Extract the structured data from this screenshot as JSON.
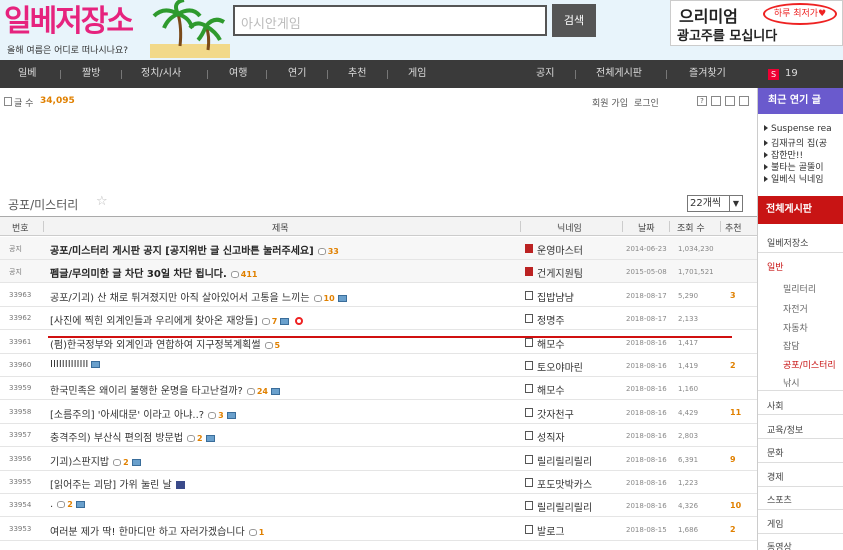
{
  "header": {
    "logo_text": "일베저장소",
    "logo_small": "간",
    "logo_tagline": "올해 여름은 어디로 떠나시나요?",
    "search_placeholder": "아시안게임",
    "search_button": "검색",
    "ad_line1": "으리미엄",
    "ad_line2": "광고주를 모십니다",
    "ad_bubble": "하루 최저가♥"
  },
  "nav": {
    "items": [
      "일베",
      "짤방",
      "정치/시사",
      "여행",
      "연기",
      "추천",
      "게임",
      "공지",
      "전체게시판",
      "즐겨찾기"
    ],
    "badge": "S",
    "count": "19"
  },
  "info": {
    "post_count_label": "글 수",
    "post_count": "34,095",
    "signup": "회원 가입",
    "login": "로그인",
    "btn_help": "?"
  },
  "board": {
    "title": "공포/미스터리",
    "per_page": "22개씩",
    "columns": {
      "num": "번호",
      "title": "제목",
      "nick": "닉네임",
      "date": "날짜",
      "views": "조회 수",
      "rec": "추천"
    }
  },
  "rows": [
    {
      "num": "공지",
      "title": "공포/미스터리 게시판 공지 [공지위반 글 신고바튼 눌러주세요]",
      "comments": "33",
      "img": false,
      "user": "운영마스터",
      "user_red": true,
      "date": "2014-06-23",
      "views": "1,034,230",
      "rec": ""
    },
    {
      "num": "공지",
      "title": "펨글/무의미한 글 차단 30일 차단 됩니다.",
      "comments": "411",
      "img": false,
      "user": "건게지원팀",
      "user_red": true,
      "date": "2015-05-08",
      "views": "1,701,521",
      "rec": ""
    },
    {
      "num": "33963",
      "title": "공포/기괴) 산 채로 튀겨졌지만 아직 살아있어서 고통을 느끼는",
      "comments": "10",
      "img": true,
      "user": "집밥냠냠",
      "user_red": false,
      "date": "2018-08-17",
      "views": "5,290",
      "rec": "3"
    },
    {
      "num": "33962",
      "title": "[사진에 찍힌 외계인들과 우리에게 찾아온 재앙들]",
      "comments": "7",
      "img": true,
      "user": "정명주",
      "user_red": false,
      "date": "2018-08-17",
      "views": "2,133",
      "rec": ""
    },
    {
      "num": "33961",
      "title": "(펌)한국정부와 외계인과 연합하여 지구정복계획썰",
      "comments": "5",
      "img": false,
      "user": "해모수",
      "user_red": false,
      "date": "2018-08-16",
      "views": "1,417",
      "rec": ""
    },
    {
      "num": "33960",
      "title": "IIIIIIIIIIIII",
      "comments": "",
      "img": true,
      "user": "토오야마린",
      "user_red": false,
      "date": "2018-08-16",
      "views": "1,419",
      "rec": "2"
    },
    {
      "num": "33959",
      "title": "한국민족은 왜이리 불행한 운명을 타고난걸까?",
      "comments": "24",
      "img": true,
      "user": "해모수",
      "user_red": false,
      "date": "2018-08-16",
      "views": "1,160",
      "rec": ""
    },
    {
      "num": "33958",
      "title": "[소름주의] '아세대문' 이라고 아냐..?",
      "comments": "3",
      "img": true,
      "user": "갓자천구",
      "user_red": false,
      "date": "2018-08-16",
      "views": "4,429",
      "rec": "11"
    },
    {
      "num": "33957",
      "title": "충격주의) 부산식 편의점 방문법",
      "comments": "2",
      "img": true,
      "user": "성직자",
      "user_red": false,
      "date": "2018-08-16",
      "views": "2,803",
      "rec": ""
    },
    {
      "num": "33956",
      "title": "기괴)스판지밥",
      "comments": "2",
      "img": true,
      "user": "릴리릴리릴리",
      "user_red": false,
      "date": "2018-08-16",
      "views": "6,391",
      "rec": "9"
    },
    {
      "num": "33955",
      "title": "[읽어주는 괴담] 가위 눌린 날",
      "comments": "",
      "img": false,
      "video": true,
      "user": "포도맛박카스",
      "user_red": false,
      "date": "2018-08-16",
      "views": "1,223",
      "rec": ""
    },
    {
      "num": "33954",
      "title": ".",
      "comments": "2",
      "img": true,
      "user": "릴리릴리릴리",
      "user_red": false,
      "date": "2018-08-16",
      "views": "4,326",
      "rec": "10"
    },
    {
      "num": "33953",
      "title": "여러분 제가 딱! 한마디만 하고 자러가겠습니다",
      "comments": "1",
      "img": false,
      "user": "발로그",
      "user_red": false,
      "date": "2018-08-15",
      "views": "1,686",
      "rec": "2"
    }
  ],
  "sidebar": {
    "popular_header": "최근 연기 글",
    "popular": [
      "Suspense rea",
      "김재규의 집(공",
      "잡한만!!",
      "불타는 골뚤이",
      "일베식 닉네임"
    ],
    "all_header": "전체게시판",
    "cats": [
      "일베저장소",
      "일반"
    ],
    "subs": [
      "밀리터리",
      "자전거",
      "자동차",
      "잡담",
      "공포/미스터리",
      "낚시"
    ],
    "more": [
      "사회",
      "교육/정보",
      "문화",
      "경제",
      "스포츠",
      "게임",
      "동영상"
    ]
  },
  "colors": {
    "accent": "#c81414",
    "purple": "#6a5acd",
    "nav": "#3a3a3a",
    "orange": "#e08000"
  }
}
